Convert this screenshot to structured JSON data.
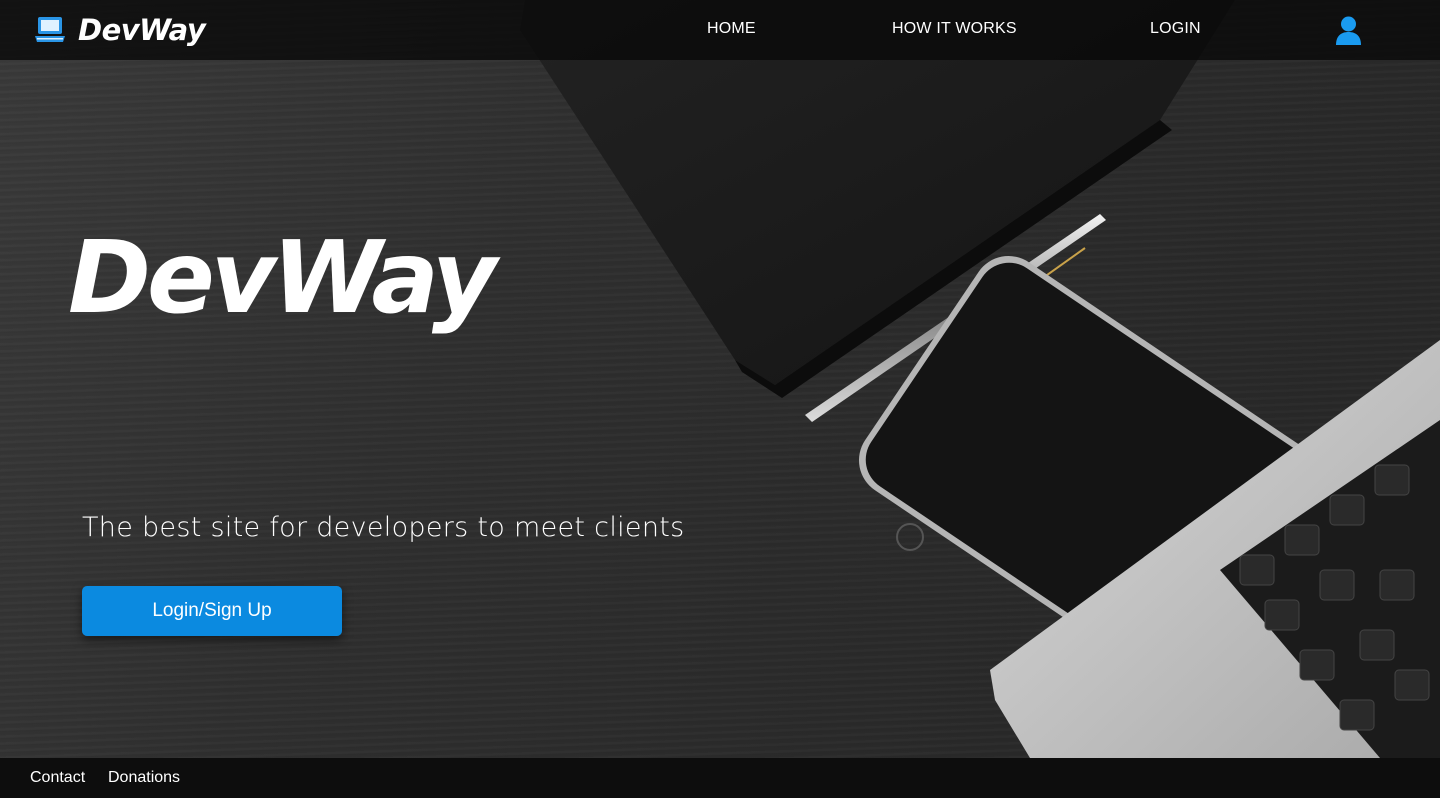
{
  "brand": {
    "name": "DevWay",
    "logo_icon": "laptop-icon",
    "accent_color": "#0b8ae0"
  },
  "nav": {
    "items": [
      {
        "label": "HOME"
      },
      {
        "label": "HOW IT WORKS"
      },
      {
        "label": "LOGIN"
      }
    ],
    "user_icon": "user-icon"
  },
  "hero": {
    "title": "DevWay",
    "tagline": "The best site for developers to meet clients",
    "cta_label": "Login/Sign Up"
  },
  "footer": {
    "links": [
      {
        "label": "Contact"
      },
      {
        "label": "Donations"
      }
    ]
  }
}
